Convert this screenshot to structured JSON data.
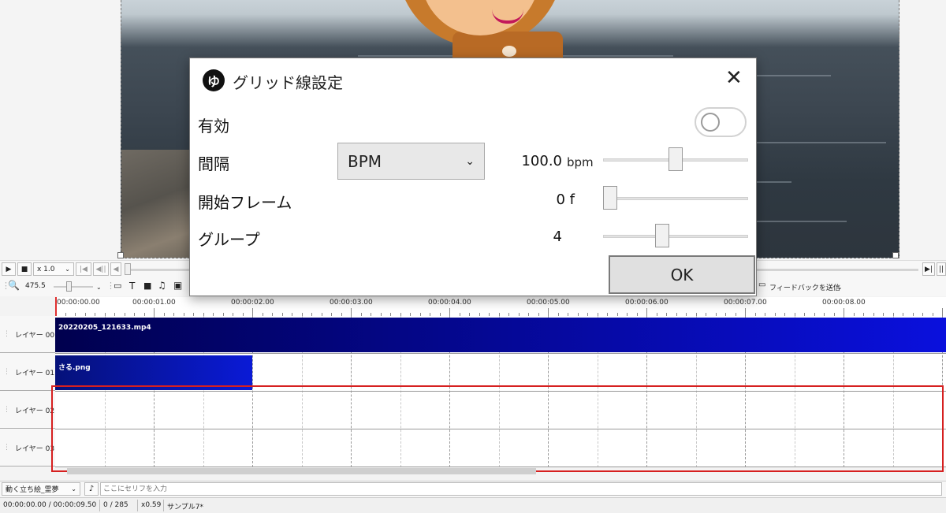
{
  "dialog": {
    "title": "グリッド線設定",
    "logo_text": "ゆ",
    "enabled_label": "有効",
    "enabled": false,
    "interval_label": "間隔",
    "interval_mode": "BPM",
    "interval_value": "100.0",
    "interval_unit": "bpm",
    "interval_slider_fraction": 0.5,
    "start_frame_label": "開始フレーム",
    "start_frame_value": "0 f",
    "start_frame_slider_fraction": 0.0,
    "group_label": "グループ",
    "group_value": "4",
    "group_slider_fraction": 0.4,
    "ok_label": "OK",
    "icons": {
      "close": "close-icon",
      "dropdown": "chevron-down-icon"
    }
  },
  "transport": {
    "speed": "x 1.0",
    "icons": [
      "play-icon",
      "stop-icon",
      "chevron-down-icon",
      "skip-start-icon",
      "step-back-icon",
      "frame-back-icon",
      "frame-forward-icon",
      "pause-icon"
    ]
  },
  "toolbar": {
    "zoom": "475.5",
    "text_tool": "T",
    "feedback": "フィードバックを送信",
    "icons": [
      "zoom-icon",
      "chat-icon",
      "text-icon",
      "camera-icon",
      "music-icon",
      "image-icon"
    ]
  },
  "ruler": {
    "ticks": [
      "00:00:00.00",
      "00:00:01.00",
      "00:00:02.00",
      "00:00:03.00",
      "00:00:04.00",
      "00:00:05.00",
      "00:00:06.00",
      "00:00:07.00",
      "00:00:08.00"
    ]
  },
  "layers": [
    {
      "label": "レイヤー 00"
    },
    {
      "label": "レイヤー 01"
    },
    {
      "label": "レイヤー 02"
    },
    {
      "label": "レイヤー 03"
    }
  ],
  "clips": [
    {
      "name": "20220205_121633.mp4"
    },
    {
      "name": "さる.png"
    }
  ],
  "speech": {
    "character": "動く立ち絵_霊夢",
    "placeholder": "ここにセリフを入力"
  },
  "status": {
    "time": "00:00:00.00 / 00:00:09.50",
    "frames": "0 / 285",
    "scale": "x0.59",
    "project": "サンプル7*"
  },
  "colors": {
    "clip_video_start": "#00004e",
    "clip_video_end": "#0a10dd",
    "clip_image_start": "#05117a",
    "clip_image_end": "#0a1ad6",
    "highlight": "#d62020"
  }
}
